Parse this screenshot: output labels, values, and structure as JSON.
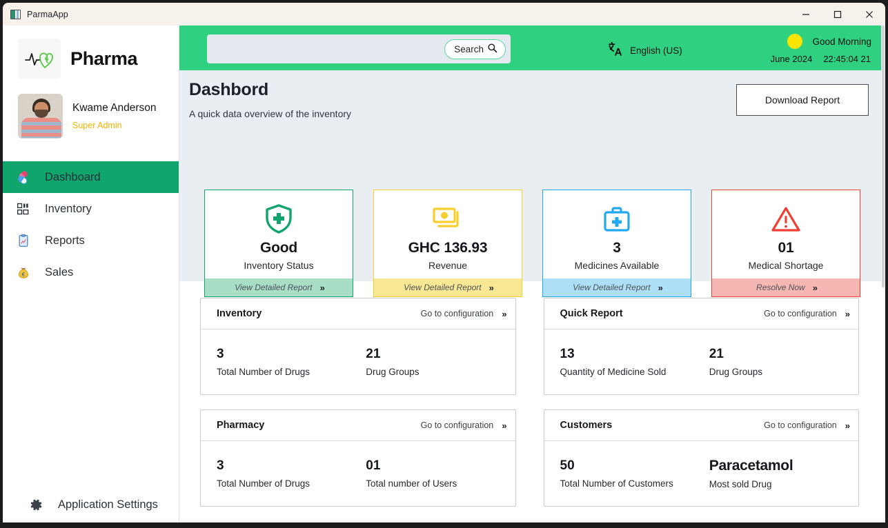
{
  "window": {
    "title": "ParmaApp",
    "icon": "app-window-icon",
    "controls": {
      "minimize": "minimize-icon",
      "maximize": "maximize-icon",
      "close": "close-icon"
    }
  },
  "sidebar": {
    "brand": {
      "name": "Pharma",
      "logo": "heartbeat-logo"
    },
    "profile": {
      "name": "Kwame Anderson",
      "role": "Super Admin"
    },
    "items": [
      {
        "label": "Dashboard",
        "icon": "pills-icon",
        "active": true
      },
      {
        "label": "Inventory",
        "icon": "inventory-blocks-icon",
        "active": false
      },
      {
        "label": "Reports",
        "icon": "clipboard-icon",
        "active": false
      },
      {
        "label": "Sales",
        "icon": "money-bag-icon",
        "active": false
      }
    ],
    "settings": {
      "label": "Application Settings",
      "icon": "gear-icon"
    }
  },
  "topbar": {
    "search": {
      "placeholder": "",
      "value": "",
      "button_label": "Search",
      "icon": "search-icon"
    },
    "language": {
      "label": "English (US)",
      "icon": "translate-icon"
    },
    "greeting": {
      "text": "Good Morning",
      "icon": "sun-icon",
      "date": "June 2024",
      "time": "22:45:04 21"
    },
    "background_color": "#2fd07f"
  },
  "page": {
    "title": "Dashbord",
    "subtitle": "A quick data overview of the inventory",
    "download_button": "Download Report"
  },
  "status_cards": [
    {
      "accent": "#10a56d",
      "icon": "shield-plus-icon",
      "value": "Good",
      "label": "Inventory Status",
      "action": "View Detailed Report"
    },
    {
      "accent": "#f6cf2e",
      "icon": "cash-icon",
      "value": "GHC 136.93",
      "label": "Revenue",
      "action": "View Detailed Report"
    },
    {
      "accent": "#22a8ef",
      "icon": "medical-kit-icon",
      "value": "3",
      "label": "Medicines Available",
      "action": "View Detailed Report"
    },
    {
      "accent": "#ef3e33",
      "icon": "warning-triangle-icon",
      "value": "01",
      "label": "Medical Shortage",
      "action": "Resolve Now"
    }
  ],
  "info_boxes": [
    {
      "title": "Inventory",
      "link": "Go to configuration",
      "stats": [
        {
          "value": "3",
          "label": "Total Number of Drugs"
        },
        {
          "value": "21",
          "label": "Drug Groups"
        }
      ]
    },
    {
      "title": "Quick Report",
      "link": "Go to configuration",
      "stats": [
        {
          "value": "13",
          "label": "Quantity of Medicine Sold"
        },
        {
          "value": "21",
          "label": "Drug Groups"
        }
      ]
    },
    {
      "title": "Pharmacy",
      "link": "Go to configuration",
      "stats": [
        {
          "value": "3",
          "label": "Total Number of Drugs"
        },
        {
          "value": "01",
          "label": "Total number of Users"
        }
      ]
    },
    {
      "title": "Customers",
      "link": "Go to configuration",
      "stats": [
        {
          "value": "50",
          "label": "Total Number of Customers"
        },
        {
          "value": "Paracetamol",
          "label": "Most sold Drug"
        }
      ]
    }
  ]
}
